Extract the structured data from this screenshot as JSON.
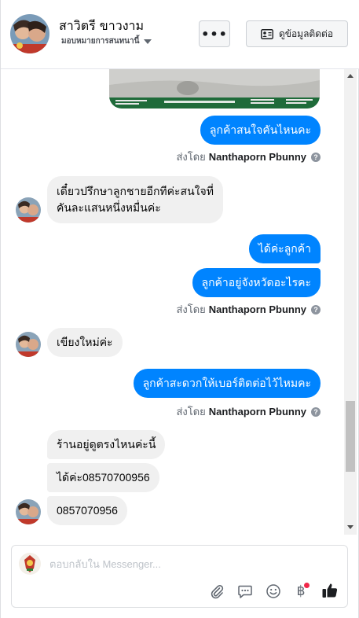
{
  "header": {
    "contact_name": "สาวิตรี ขาวงาม",
    "assign_label": "มอบหมายการสนทนานี้",
    "more_label": "•••",
    "info_button_label": "ดูข้อมูลติดต่อ"
  },
  "messages": [
    {
      "direction": "out",
      "text": "ลูกค้าสนใจคันไหนคะ"
    },
    {
      "direction": "in",
      "lines": [
        "เดี๋ยวปรึกษาลูกชายอีกทีค่ะสนใจที่",
        "คันละแสนหนึ่งหมื่นค่ะ"
      ]
    },
    {
      "direction": "out",
      "text": "ได้ค่ะลูกค้า"
    },
    {
      "direction": "out",
      "text": "ลูกค้าอยู่จังหวัดอะไรคะ"
    },
    {
      "direction": "in",
      "text": "เขียงใหม่ค่ะ"
    },
    {
      "direction": "out",
      "text": "ลูกค้าสะดวกให้เบอร์ติดต่อไว้ไหมคะ"
    },
    {
      "direction": "in",
      "text": "ร้านอยู่ดูตรงไหนค่ะนี้"
    },
    {
      "direction": "in",
      "text": "ได้ค่ะ08570700956"
    },
    {
      "direction": "in",
      "text": "0857070956"
    }
  ],
  "sent_by": {
    "prefix": "ส่งโดย",
    "agent": "Nanthaporn Pbunny",
    "help_icon": "?"
  },
  "composer": {
    "placeholder": "ตอบกลับใน Messenger...",
    "baht_symbol": "฿",
    "icons": [
      "attachment-icon",
      "saved-reply-icon",
      "emoji-icon",
      "payment-icon",
      "like-icon"
    ]
  },
  "colors": {
    "outgoing_bubble": "#0084ff",
    "incoming_bubble": "#f0f0f0",
    "like_icon": "#1c1e21",
    "notification_dot": "#f02849"
  }
}
